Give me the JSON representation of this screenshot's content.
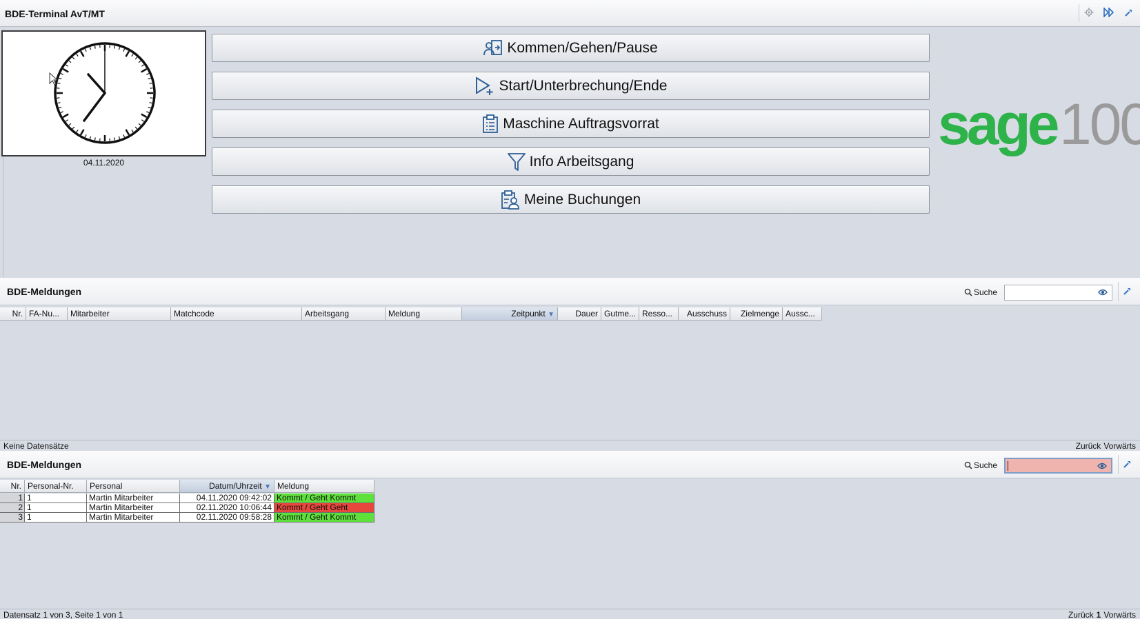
{
  "window": {
    "title": "BDE-Terminal AvT/MT"
  },
  "titlebar_tools": [
    "settings-icon",
    "forward-icon",
    "wrench-icon"
  ],
  "clock": {
    "date": "04.11.2020",
    "hour": 7,
    "minute": 0
  },
  "buttons": [
    {
      "label": "Kommen/Gehen/Pause",
      "icon": "person-login-icon"
    },
    {
      "label": "Start/Unterbrechung/Ende",
      "icon": "play-plus-icon"
    },
    {
      "label": "Maschine Auftragsvorrat",
      "icon": "clipboard-icon"
    },
    {
      "label": "Info Arbeitsgang",
      "icon": "filter-icon"
    },
    {
      "label": "Meine Buchungen",
      "icon": "clipboard-person-icon"
    }
  ],
  "logo": {
    "brand": "sage",
    "product": "100",
    "brand_color": "#2eb24a",
    "product_color": "#9a9a9a"
  },
  "panel1": {
    "title": "BDE-Meldungen",
    "search_label": "Suche",
    "search_value": "",
    "columns": [
      "Nr.",
      "FA-Nu...",
      "Mitarbeiter",
      "Matchcode",
      "Arbeitsgang",
      "Meldung",
      "Zeitpunkt",
      "Dauer",
      "Gutme...",
      "Resso...",
      "Ausschuss",
      "Zielmenge",
      "Aussc..."
    ],
    "sorted_column": "Zeitpunkt",
    "status_left": "Keine Datensätze",
    "nav_back": "Zurück",
    "nav_forward": "Vorwärts"
  },
  "panel2": {
    "title": "BDE-Meldungen",
    "search_label": "Suche",
    "search_value": "",
    "columns": [
      "Nr.",
      "Personal-Nr.",
      "Personal",
      "Datum/Uhrzeit",
      "Meldung"
    ],
    "sorted_column": "Datum/Uhrzeit",
    "rows": [
      {
        "nr": "1",
        "personal_nr": "1",
        "personal": "Martin Mitarbeiter",
        "datum": "04.11.2020 09:42:02",
        "meldung": "Kommt / Geht Kommt",
        "color": "#5fe13c"
      },
      {
        "nr": "2",
        "personal_nr": "1",
        "personal": "Martin Mitarbeiter",
        "datum": "02.11.2020 10:06:44",
        "meldung": "Kommt / Geht Geht",
        "color": "#e8473d"
      },
      {
        "nr": "3",
        "personal_nr": "1",
        "personal": "Martin Mitarbeiter",
        "datum": "02.11.2020 09:58:28",
        "meldung": "Kommt / Geht Kommt",
        "color": "#5fe13c"
      }
    ],
    "status_left": "Datensatz 1 von 3, Seite 1 von 1",
    "nav_back": "Zurück",
    "nav_page": "1",
    "nav_forward": "Vorwärts"
  }
}
